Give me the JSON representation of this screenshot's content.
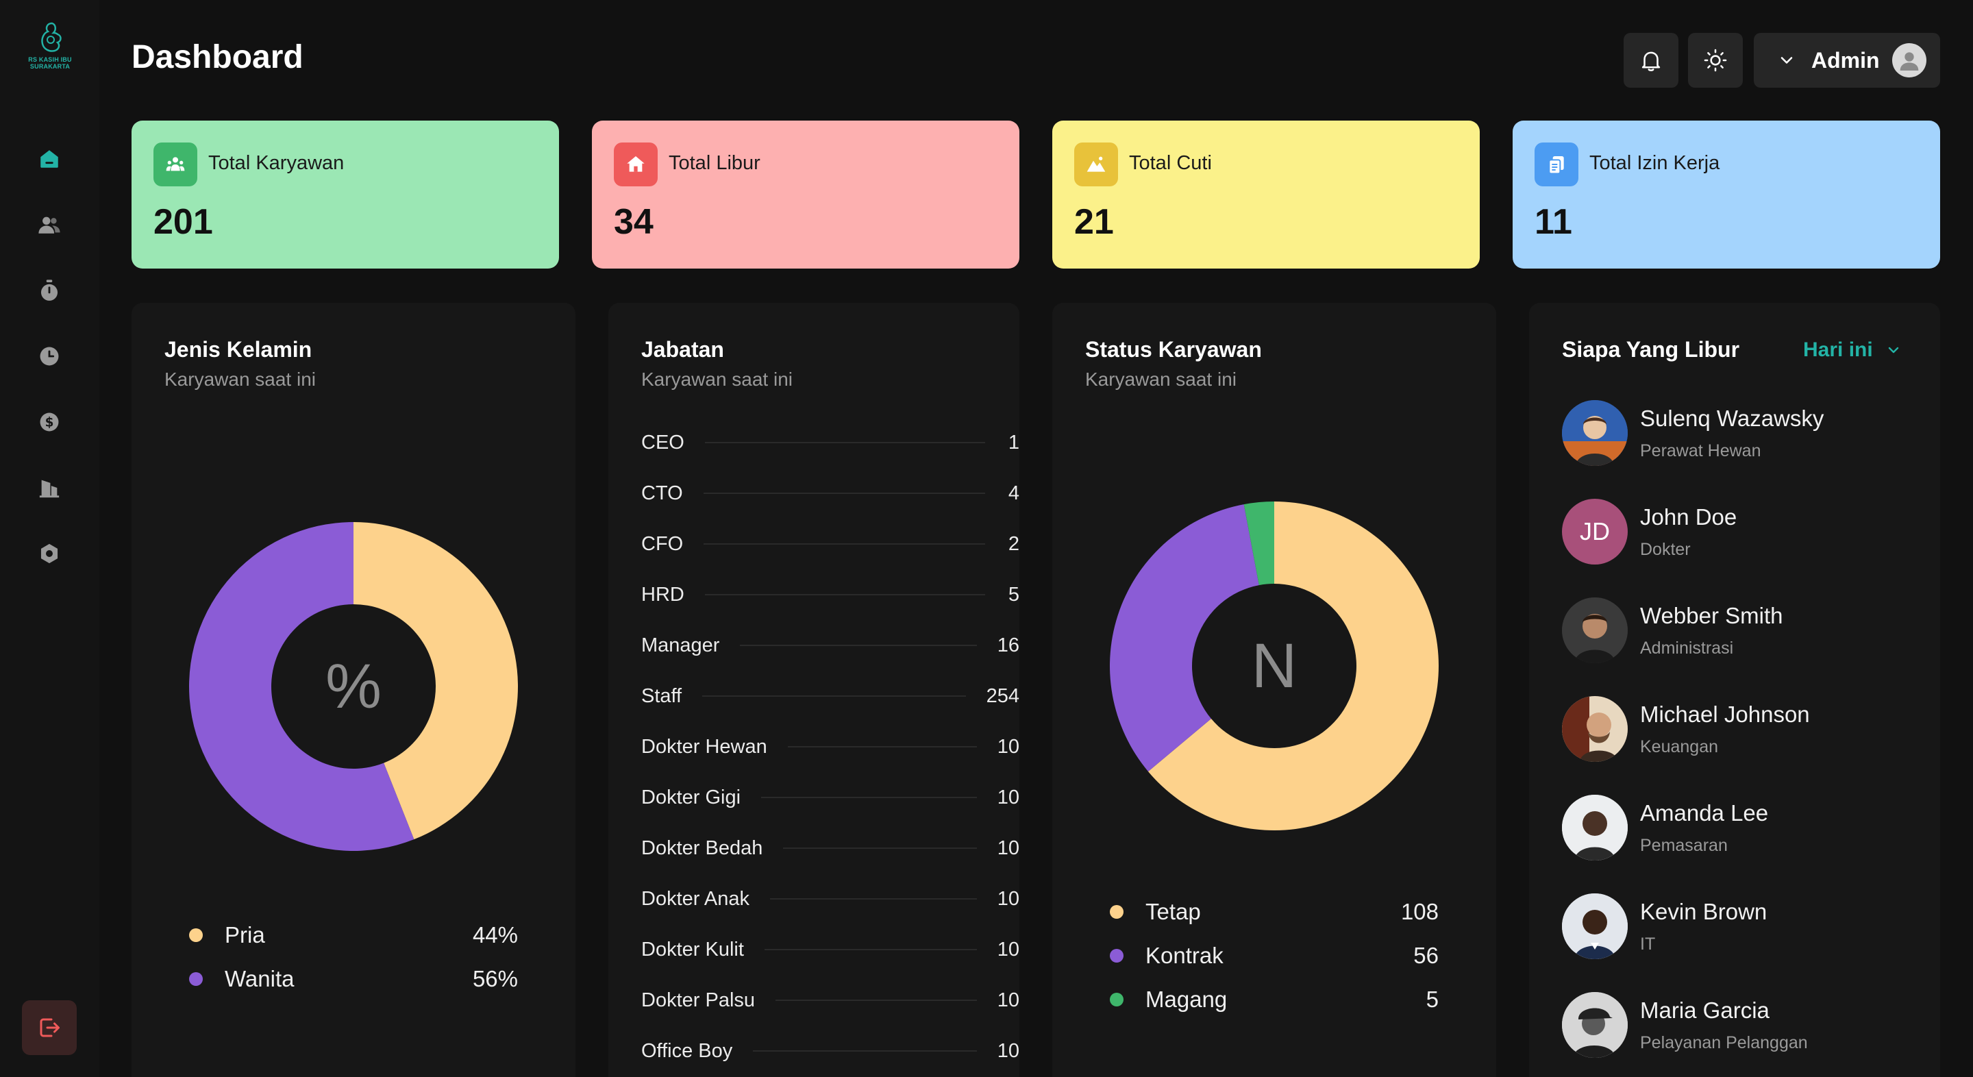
{
  "app": {
    "logo_text": [
      "RS KASIH IBU",
      "SURAKARTA"
    ]
  },
  "header": {
    "title": "Dashboard",
    "user_label": "Admin"
  },
  "sidebar": {
    "items": [
      {
        "icon": "home-icon",
        "active": true
      },
      {
        "icon": "users-icon",
        "active": false
      },
      {
        "icon": "stopwatch-icon",
        "active": false
      },
      {
        "icon": "clock-icon",
        "active": false
      },
      {
        "icon": "dollar-icon",
        "active": false
      },
      {
        "icon": "building-icon",
        "active": false
      },
      {
        "icon": "settings-icon",
        "active": false
      }
    ],
    "logout_icon": "logout-icon"
  },
  "stats": [
    {
      "label": "Total Karyawan",
      "value": "201",
      "bg": "#9be7b4",
      "icon_bg": "#3fb66b",
      "icon": "group-icon"
    },
    {
      "label": "Total Libur",
      "value": "34",
      "bg": "#fdb0b0",
      "icon_bg": "#ef5a5a",
      "icon": "house-icon"
    },
    {
      "label": "Total Cuti",
      "value": "21",
      "bg": "#fbf18a",
      "icon_bg": "#e8c23a",
      "icon": "mountain-icon"
    },
    {
      "label": "Total Izin Kerja",
      "value": "11",
      "bg": "#a4d4fd",
      "icon_bg": "#4c9cf2",
      "icon": "documents-icon"
    }
  ],
  "gender": {
    "title": "Jenis Kelamin",
    "subtitle": "Karyawan saat ini",
    "center_symbol": "%",
    "legend": [
      {
        "label": "Pria",
        "value": "44%",
        "color": "#fdd28c"
      },
      {
        "label": "Wanita",
        "value": "56%",
        "color": "#8b5cd6"
      }
    ]
  },
  "jabatan": {
    "title": "Jabatan",
    "subtitle": "Karyawan saat ini",
    "rows": [
      {
        "label": "CEO",
        "value": "1"
      },
      {
        "label": "CTO",
        "value": "4"
      },
      {
        "label": "CFO",
        "value": "2"
      },
      {
        "label": "HRD",
        "value": "5"
      },
      {
        "label": "Manager",
        "value": "16"
      },
      {
        "label": "Staff",
        "value": "254"
      },
      {
        "label": "Dokter Hewan",
        "value": "10"
      },
      {
        "label": "Dokter Gigi",
        "value": "10"
      },
      {
        "label": "Dokter Bedah",
        "value": "10"
      },
      {
        "label": "Dokter Anak",
        "value": "10"
      },
      {
        "label": "Dokter Kulit",
        "value": "10"
      },
      {
        "label": "Dokter Palsu",
        "value": "10"
      },
      {
        "label": "Office Boy",
        "value": "10"
      }
    ]
  },
  "status": {
    "title": "Status Karyawan",
    "subtitle": "Karyawan saat ini",
    "center_symbol": "N",
    "legend": [
      {
        "label": "Tetap",
        "value": "108",
        "color": "#fdd28c"
      },
      {
        "label": "Kontrak",
        "value": "56",
        "color": "#8b5cd6"
      },
      {
        "label": "Magang",
        "value": "5",
        "color": "#3fb66b"
      }
    ]
  },
  "libur": {
    "title": "Siapa Yang Libur",
    "filter": "Hari ini",
    "people": [
      {
        "name": "Sulenq Wazawsky",
        "role": "Perawat Hewan",
        "avatar": "photo"
      },
      {
        "name": "John Doe",
        "role": "Dokter",
        "avatar": "initials",
        "initials": "JD",
        "color": "#a8507a"
      },
      {
        "name": "Webber Smith",
        "role": "Administrasi",
        "avatar": "photo"
      },
      {
        "name": "Michael Johnson",
        "role": "Keuangan",
        "avatar": "photo"
      },
      {
        "name": "Amanda Lee",
        "role": "Pemasaran",
        "avatar": "photo"
      },
      {
        "name": "Kevin Brown",
        "role": "IT",
        "avatar": "photo"
      },
      {
        "name": "Maria Garcia",
        "role": "Pelayanan Pelanggan",
        "avatar": "photo"
      }
    ]
  },
  "chart_data": [
    {
      "type": "pie",
      "title": "Jenis Kelamin",
      "categories": [
        "Pria",
        "Wanita"
      ],
      "values": [
        44,
        56
      ],
      "colors": [
        "#fdd28c",
        "#8b5cd6"
      ]
    },
    {
      "type": "pie",
      "title": "Status Karyawan",
      "categories": [
        "Tetap",
        "Kontrak",
        "Magang"
      ],
      "values": [
        108,
        56,
        5
      ],
      "colors": [
        "#fdd28c",
        "#8b5cd6",
        "#3fb66b"
      ]
    }
  ]
}
